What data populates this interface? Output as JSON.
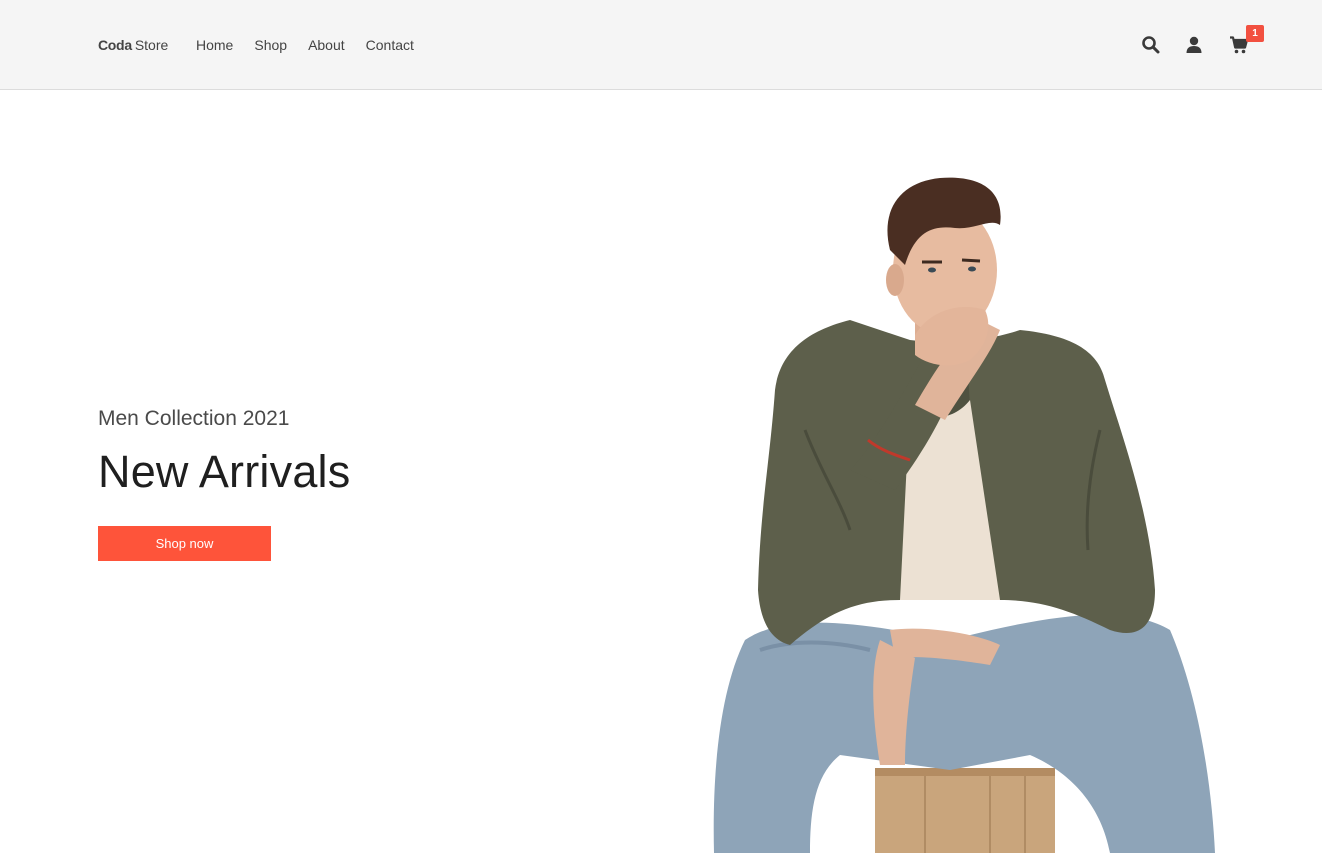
{
  "brand": {
    "bold": "Coda",
    "light": "Store"
  },
  "nav": {
    "links": [
      "Home",
      "Shop",
      "About",
      "Contact"
    ]
  },
  "header_icons": {
    "search": "search-icon",
    "user": "user-icon",
    "cart": "cart-icon"
  },
  "cart": {
    "count": "1"
  },
  "hero": {
    "subtitle": "Men Collection 2021",
    "title": "New Arrivals",
    "cta_label": "Shop now"
  },
  "colors": {
    "accent": "#fe543a",
    "badge": "#f25040",
    "navbar_bg": "#f5f5f5",
    "jacket": "#5d5f4b",
    "jeans": "#8ea4b8",
    "stool": "#c9a57c"
  }
}
